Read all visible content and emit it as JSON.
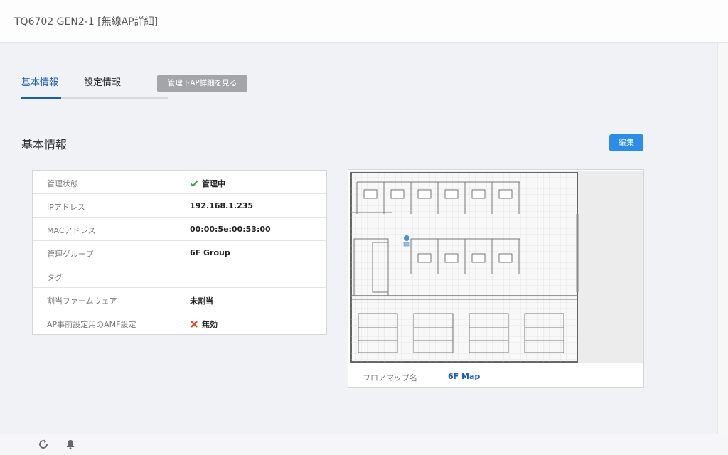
{
  "header": {
    "title": "TQ6702 GEN2-1 [無線AP詳細]"
  },
  "tabs": [
    {
      "label": "基本情報",
      "active": true
    },
    {
      "label": "設定情報",
      "active": false
    }
  ],
  "view_managed_ap_button": "管理下AP詳細を見る",
  "section": {
    "title": "基本情報",
    "edit_button": "編集"
  },
  "info_rows": [
    {
      "label": "管理状態",
      "value": "管理中",
      "icon": "check-icon"
    },
    {
      "label": "IPアドレス",
      "value": "192.168.1.235"
    },
    {
      "label": "MACアドレス",
      "value": "00:00:5e:00:53:00"
    },
    {
      "label": "管理グループ",
      "value": "6F Group"
    },
    {
      "label": "タグ",
      "value": ""
    },
    {
      "label": "割当ファームウェア",
      "value": "未割当"
    },
    {
      "label": "AP事前設定用のAMF設定",
      "value": "無効",
      "icon": "cross-icon"
    }
  ],
  "floor_map": {
    "label": "フロアマップ名",
    "value": "6F Map"
  },
  "bottom_icons": [
    "refresh-icon",
    "bell-icon"
  ],
  "colors": {
    "accent": "#2b8de8",
    "tab_active": "#1b5fb0",
    "check": "#3aa64b",
    "cross": "#e0472b"
  }
}
